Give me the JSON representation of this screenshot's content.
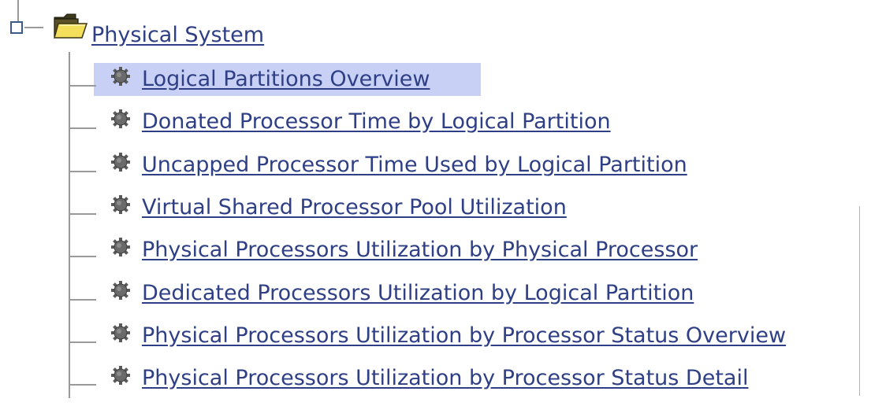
{
  "tree": {
    "root": {
      "label": "Physical System",
      "expanded": true,
      "icon": "folder-icon"
    },
    "children": [
      {
        "label": "Logical Partitions Overview",
        "selected": true,
        "icon": "gear-icon"
      },
      {
        "label": "Donated Processor Time by Logical Partition",
        "selected": false,
        "icon": "gear-icon"
      },
      {
        "label": "Uncapped Processor Time Used by Logical Partition",
        "selected": false,
        "icon": "gear-icon"
      },
      {
        "label": "Virtual Shared Processor Pool Utilization",
        "selected": false,
        "icon": "gear-icon"
      },
      {
        "label": "Physical Processors Utilization by Physical Processor",
        "selected": false,
        "icon": "gear-icon"
      },
      {
        "label": "Dedicated Processors Utilization by Logical Partition",
        "selected": false,
        "icon": "gear-icon"
      },
      {
        "label": "Physical Processors Utilization by Processor Status Overview",
        "selected": false,
        "icon": "gear-icon"
      },
      {
        "label": "Physical Processors Utilization by Processor Status Detail",
        "selected": false,
        "icon": "gear-icon"
      }
    ]
  },
  "colors": {
    "link": "#2e3f86",
    "selection": "#c8d0f5",
    "connector": "#9a9a9a",
    "toggle_border": "#3b5a8a"
  }
}
